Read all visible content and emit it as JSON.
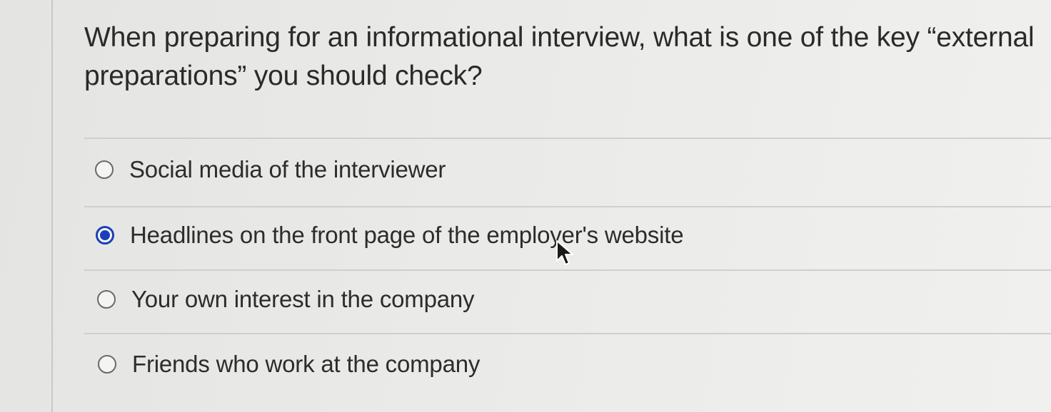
{
  "question": {
    "text": "When preparing for an informational interview, what is one of the key “external preparations” you should check?"
  },
  "options": [
    {
      "label": "Social media of the interviewer",
      "selected": false
    },
    {
      "label": "Headlines on the front page of the employer's website",
      "selected": true
    },
    {
      "label": "Your own interest in the company",
      "selected": false
    },
    {
      "label": "Friends who work at the company",
      "selected": false
    }
  ],
  "colors": {
    "accent": "#1b3fb6",
    "text": "#2c2c2c"
  },
  "icons": {
    "cursor": "mouse-pointer-icon"
  }
}
